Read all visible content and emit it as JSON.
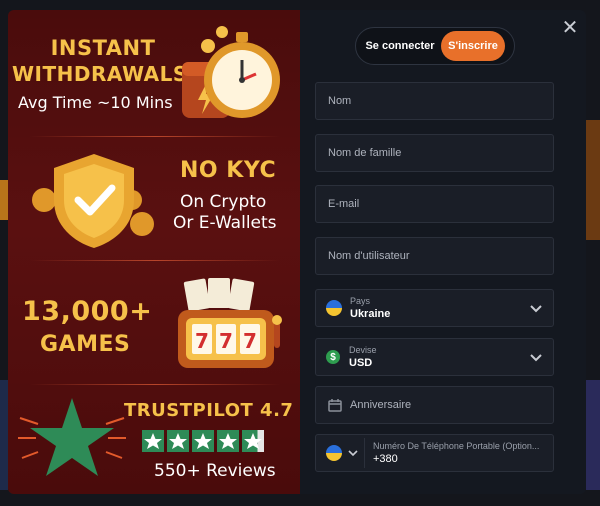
{
  "promo": {
    "withdrawals": {
      "title_line1": "INSTANT",
      "title_line2": "WITHDRAWALS",
      "subtitle": "Avg Time ~10 Mins"
    },
    "kyc": {
      "title": "NO KYC",
      "line1": "On Crypto",
      "line2": "Or E-Wallets"
    },
    "games": {
      "title_line1": "13,000+",
      "title_line2": "GAMES"
    },
    "trustpilot": {
      "title": "TRUSTPILOT 4.7",
      "rating": 4.7,
      "reviews": "550+ Reviews"
    }
  },
  "auth_toggle": {
    "login_label": "Se connecter",
    "signup_label": "S'inscrire"
  },
  "form": {
    "name_placeholder": "Nom",
    "surname_placeholder": "Nom de famille",
    "email_placeholder": "E-mail",
    "username_placeholder": "Nom d'utilisateur",
    "country": {
      "label": "Pays",
      "value": "Ukraine"
    },
    "currency": {
      "label": "Devise",
      "value": "USD"
    },
    "birthday_placeholder": "Anniversaire",
    "phone": {
      "label": "Numéro De Téléphone Portable (Option...",
      "value": "+380"
    }
  },
  "colors": {
    "accent": "#e8702a",
    "gold": "#f6c14a",
    "promo_bg": "#4a0c0c",
    "form_bg": "#141820",
    "trustpilot_green": "#2e8b57"
  }
}
